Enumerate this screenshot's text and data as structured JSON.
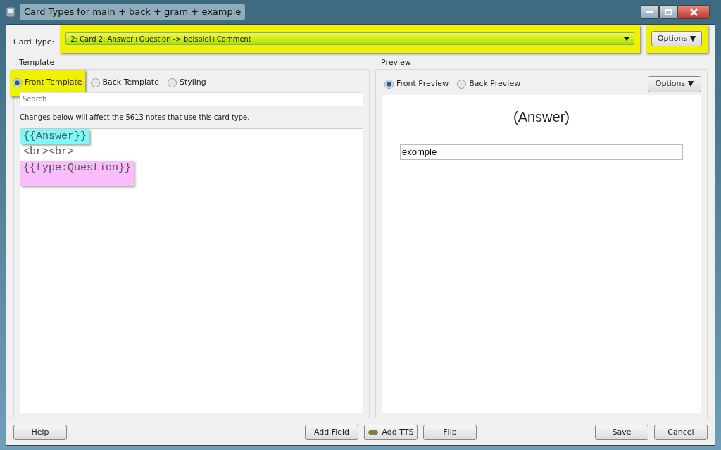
{
  "window": {
    "title": "Card Types for main + back + gram + example"
  },
  "card_type": {
    "label": "Card Type:",
    "value": "2: Card 2: Answer+Question -> beispiel+Comment",
    "highlighted": true
  },
  "top_options": {
    "label": "Options ▼",
    "highlighted": true
  },
  "template": {
    "title": "Template",
    "radios": [
      {
        "label": "Front Template",
        "selected": true,
        "highlighted": true
      },
      {
        "label": "Back Template",
        "selected": false,
        "highlighted": false
      },
      {
        "label": "Styling",
        "selected": false,
        "highlighted": false
      }
    ],
    "search": {
      "placeholder": "Search"
    },
    "notice": "Changes below will affect the 5613 notes that use this card type.",
    "lines": [
      {
        "text": "{{Answer}}",
        "color": "#7df9f9"
      },
      {
        "text": "<br><br>"
      },
      {
        "text": "{{type:Question}}",
        "color": "#fbbcfb"
      }
    ]
  },
  "preview": {
    "title": "Preview",
    "radios": [
      {
        "label": "Front Preview",
        "selected": true
      },
      {
        "label": "Back Preview",
        "selected": false
      }
    ],
    "options": "Options ▼",
    "heading": "(Answer)",
    "answer_value": "exomple"
  },
  "buttons": {
    "left": [
      "Help"
    ],
    "middle": [
      {
        "label": "Add Field",
        "kind": "plain"
      },
      {
        "label": "Add TTS",
        "kind": "icon"
      },
      {
        "label": "Flip",
        "kind": "plain"
      }
    ],
    "right": [
      "Save",
      "Cancel"
    ]
  }
}
